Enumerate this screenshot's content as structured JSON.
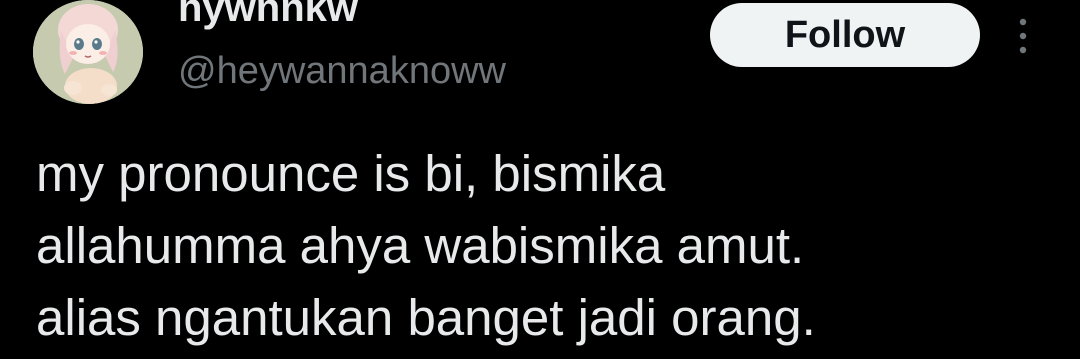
{
  "user": {
    "display_name": "hywnnkw",
    "handle": "@heywannaknoww"
  },
  "actions": {
    "follow_label": "Follow",
    "more_icon": "more-vertical-icon"
  },
  "tweet": {
    "lines": [
      "my pronounce is bi, bismika",
      "allahumma ahya wabismika amut.",
      "alias ngantukan banget jadi orang."
    ]
  },
  "colors": {
    "background": "#000000",
    "primary_text": "#e7e9ea",
    "secondary_text": "#71767b",
    "follow_bg": "#eff3f4",
    "follow_text": "#0f1419"
  }
}
